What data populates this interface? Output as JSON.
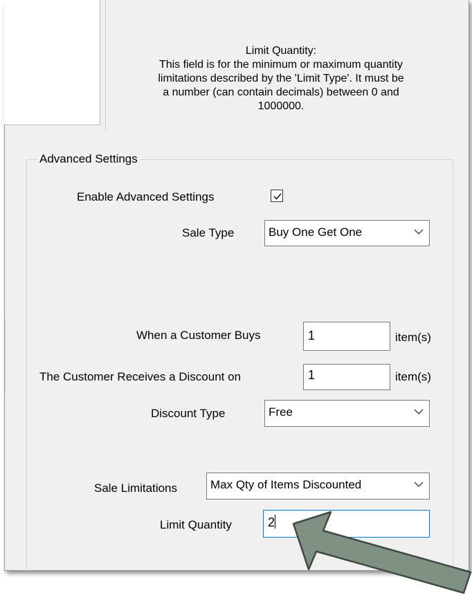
{
  "help": {
    "title": "Limit Quantity:",
    "line1": "This field is for the minimum or maximum quantity",
    "line2": "limitations described by the 'Limit Type'. It must be",
    "line3": "a number (can contain decimals) between 0 and",
    "line4": "1000000."
  },
  "advanced": {
    "group_label": "Advanced Settings",
    "enable_label": "Enable Advanced Settings",
    "enable_checked": true,
    "sale_type_label": "Sale Type",
    "sale_type_value": "Buy One Get One",
    "customer_buys_label": "When a Customer Buys",
    "customer_buys_value": "1",
    "customer_buys_unit": "item(s)",
    "receives_label": "The Customer Receives a Discount on",
    "receives_value": "1",
    "receives_unit": "item(s)",
    "discount_type_label": "Discount Type",
    "discount_type_value": "Free",
    "sale_limitations_label": "Sale Limitations",
    "sale_limitations_value": "Max Qty of Items Discounted",
    "limit_quantity_label": "Limit Quantity",
    "limit_quantity_value": "2"
  },
  "colors": {
    "arrow_fill": "#7f9183",
    "arrow_stroke": "#3f4a40",
    "focus_border": "#0078d7"
  }
}
